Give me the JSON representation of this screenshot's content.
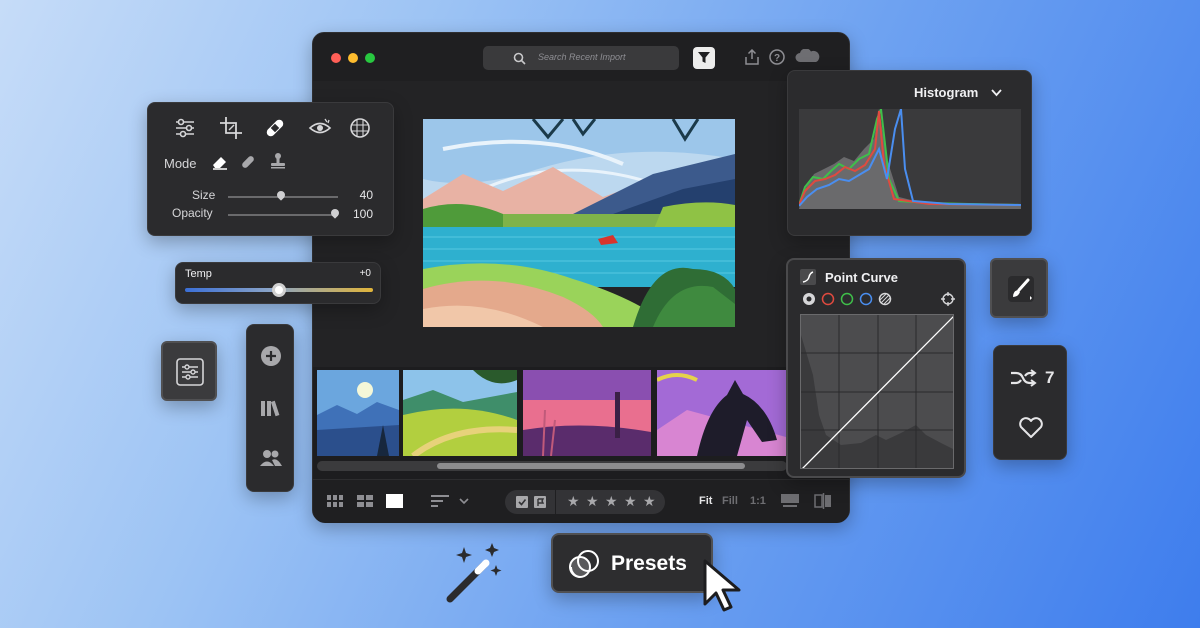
{
  "main_window": {
    "search_placeholder": "Search Recent Import",
    "zoom_options": [
      "Fit",
      "Fill",
      "1:1"
    ],
    "rating_stars": "★ ★ ★ ★ ★"
  },
  "heal_panel": {
    "mode_label": "Mode",
    "size_label": "Size",
    "size_value": "40",
    "opacity_label": "Opacity",
    "opacity_value": "100",
    "size_level": 0.48,
    "opacity_level": 0.97
  },
  "temp_panel": {
    "label": "Temp",
    "value": "+0",
    "level": 0.5
  },
  "histogram": {
    "title": "Histogram"
  },
  "point_curve": {
    "title": "Point Curve"
  },
  "right_card": {
    "remix_count": "7"
  },
  "presets_button": {
    "label": "Presets"
  },
  "colors": {
    "red_channel": "#e04a3f",
    "green_channel": "#3fbf4a",
    "blue_channel": "#4a8ef0",
    "temp_cool": "#3b6fd6",
    "temp_warm": "#e0b43a"
  },
  "icons": [
    "search-icon",
    "filter-icon",
    "share-icon",
    "help-icon",
    "cloud-icon",
    "sliders-icon",
    "crop-icon",
    "bandage-icon",
    "redeye-icon",
    "mask-icon",
    "eraser-icon",
    "heal-icon",
    "stamp-icon",
    "plus-icon",
    "library-icon",
    "people-icon",
    "brush-icon",
    "remix-icon",
    "heart-icon",
    "magic-wand-icon",
    "cursor-icon",
    "curve-icon"
  ]
}
